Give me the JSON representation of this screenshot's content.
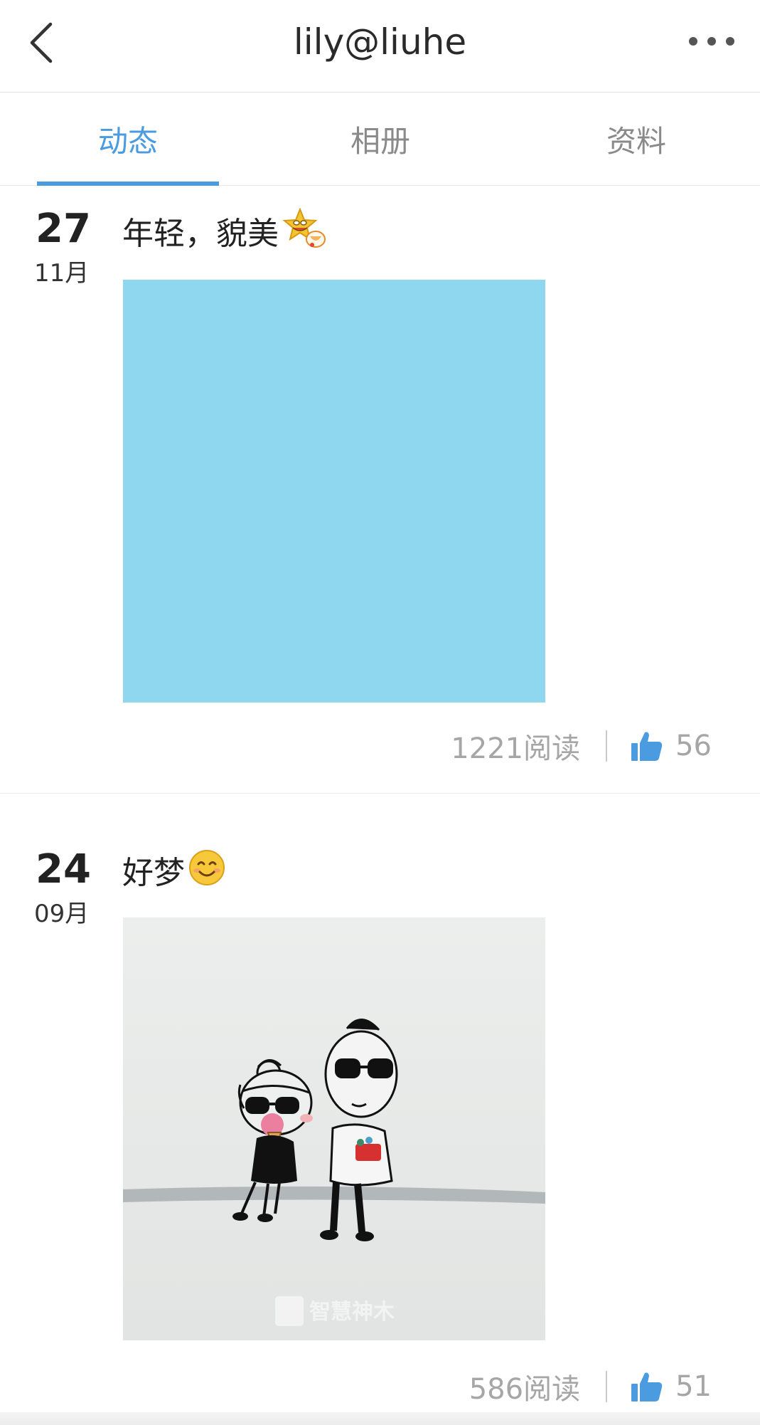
{
  "header": {
    "title": "lily@liuhe"
  },
  "tabs": [
    {
      "label": "动态",
      "active": true
    },
    {
      "label": "相册",
      "active": false
    },
    {
      "label": "资料",
      "active": false
    }
  ],
  "posts": [
    {
      "day": "27",
      "month": "11月",
      "text": "年轻，貌美",
      "emoji": "drooling-star-emoji",
      "image": "blue-placeholder-image",
      "reads": "1221阅读",
      "likes": "56"
    },
    {
      "day": "24",
      "month": "09月",
      "text": "好梦",
      "emoji": "smiling-face-emoji",
      "image": "cartoon-couple-drawing",
      "watermark": "智慧神木",
      "reads": "586阅读",
      "likes": "51"
    }
  ],
  "colors": {
    "accent": "#4b9be0",
    "placeholder_blue": "#8fd6ef",
    "muted_text": "#a6a6a6"
  }
}
